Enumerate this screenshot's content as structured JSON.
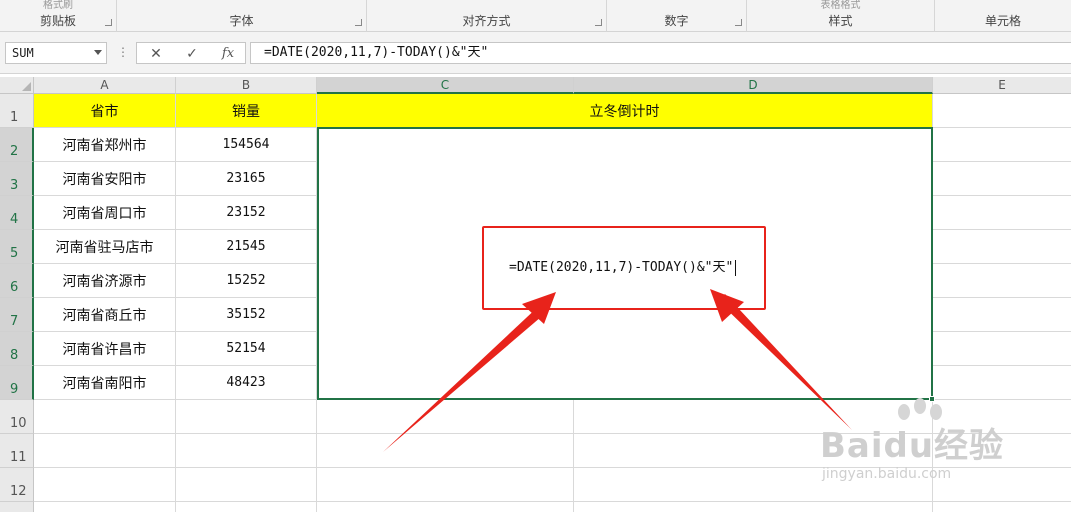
{
  "ribbon": {
    "groups": [
      {
        "label": "剪贴板",
        "faded": "格式刷"
      },
      {
        "label": "字体"
      },
      {
        "label": "对齐方式"
      },
      {
        "label": "数字"
      },
      {
        "label": "样式",
        "faded": "表格格式"
      },
      {
        "label": "单元格"
      }
    ]
  },
  "formula_bar": {
    "name_box": "SUM",
    "cancel_icon": "✕",
    "enter_icon": "✓",
    "fx_label": "fx",
    "formula": "=DATE(2020,11,7)-TODAY()&\"天\""
  },
  "columns": [
    "A",
    "B",
    "C",
    "D",
    "E"
  ],
  "rows": [
    "1",
    "2",
    "3",
    "4",
    "5",
    "6",
    "7",
    "8",
    "9",
    "10",
    "11",
    "12"
  ],
  "table": {
    "headers": {
      "a": "省市",
      "b": "销量",
      "cd": "立冬倒计时"
    },
    "data": [
      {
        "city": "河南省郑州市",
        "sales": "154564"
      },
      {
        "city": "河南省安阳市",
        "sales": "23165"
      },
      {
        "city": "河南省周口市",
        "sales": "23152"
      },
      {
        "city": "河南省驻马店市",
        "sales": "21545"
      },
      {
        "city": "河南省济源市",
        "sales": "15252"
      },
      {
        "city": "河南省商丘市",
        "sales": "35152"
      },
      {
        "city": "河南省许昌市",
        "sales": "52154"
      },
      {
        "city": "河南省南阳市",
        "sales": "48423"
      }
    ]
  },
  "edit_cell": {
    "text": "=DATE(2020,11,7)-TODAY()&\"天\""
  },
  "colors": {
    "accent": "#217346",
    "highlight": "#ffff00",
    "annotation": "#e8231b"
  },
  "watermark": {
    "main": "Baidu经验",
    "sub": "jingyan.baidu.com"
  }
}
